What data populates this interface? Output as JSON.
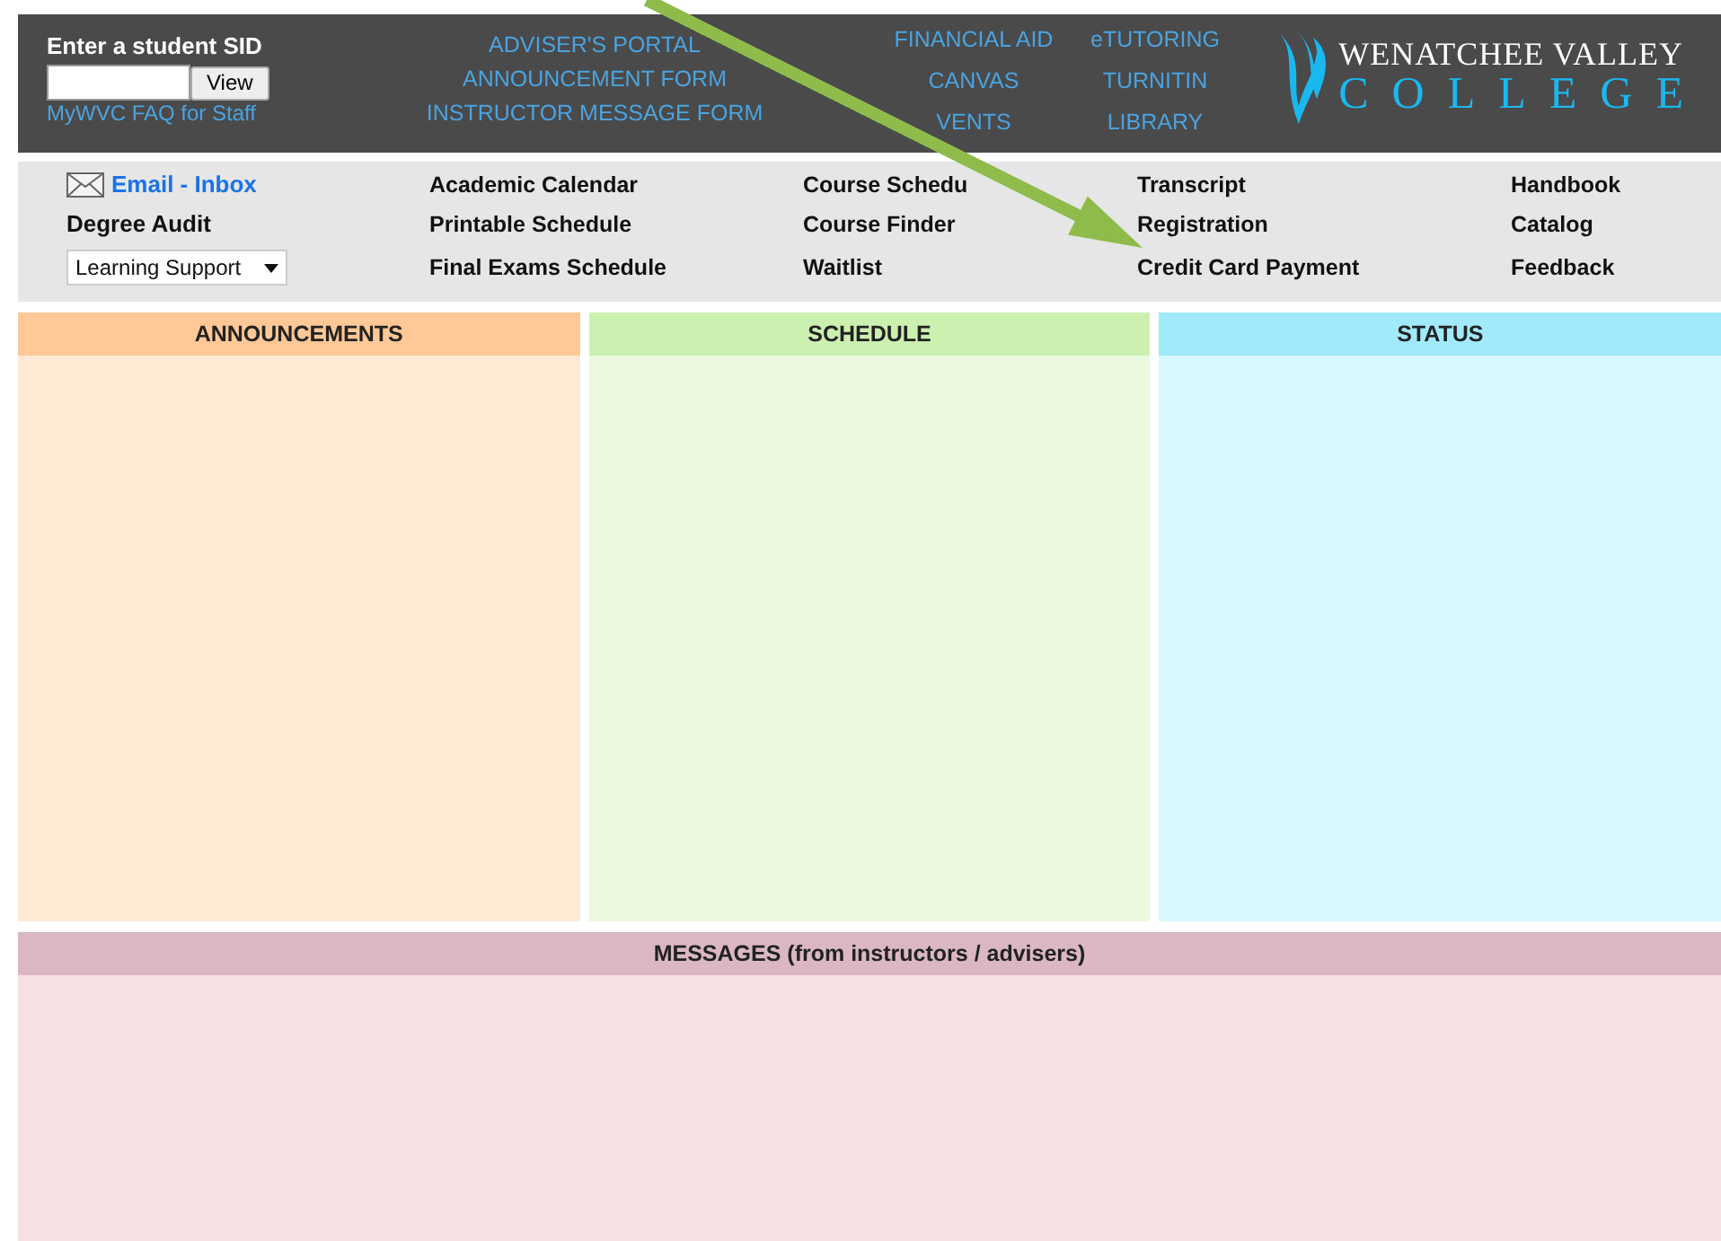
{
  "header": {
    "sid_label": "Enter a student SID",
    "view_button": "View",
    "faq_link": "MyWVC FAQ for Staff",
    "portal_links": [
      "ADVISER'S PORTAL",
      "ANNOUNCEMENT FORM",
      "INSTRUCTOR MESSAGE FORM"
    ],
    "link_columns": [
      [
        "FINANCIAL AID",
        "CANVAS",
        "VENTS"
      ],
      [
        "eTUTORING",
        "TURNITIN",
        "LIBRARY"
      ]
    ],
    "logo": {
      "line_1": "WENATCHEE VALLEY",
      "line_2": "COLLEGE"
    }
  },
  "nav": {
    "email_link": "Email - Inbox",
    "degree_audit": "Degree Audit",
    "dropdown": "Learning Support",
    "columns": [
      [
        "Academic Calendar",
        "Printable Schedule",
        "Final Exams Schedule"
      ],
      [
        "Course Schedu",
        "Course Finder",
        "Waitlist"
      ],
      [
        "Transcript",
        "Registration",
        "Credit Card Payment"
      ],
      [
        "Handbook",
        "Catalog",
        "Feedback"
      ]
    ]
  },
  "panels": [
    {
      "title": "ANNOUNCEMENTS",
      "color": "#ffc896"
    },
    {
      "title": "SCHEDULE",
      "color": "#ccf0b0"
    },
    {
      "title": "STATUS",
      "color": "#a0eafc"
    }
  ],
  "messages": {
    "title": "MESSAGES (from instructors / advisers)"
  }
}
